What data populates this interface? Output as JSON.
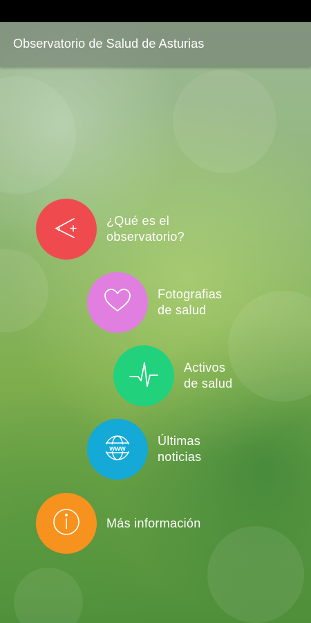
{
  "app_bar": {
    "title": "Observatorio de Salud de Asturias"
  },
  "menu": {
    "items": [
      {
        "label": "¿Qué es el\n observatorio?",
        "icon": "angle-plus-icon",
        "color": "#EF4B4F"
      },
      {
        "label": "Fotografias\n de salud",
        "icon": "heart-icon",
        "color": "#E07FE0"
      },
      {
        "label": "Activos\nde salud",
        "icon": "heartbeat-icon",
        "color": "#22D17C"
      },
      {
        "label": "Últimas\nnoticias",
        "icon": "globe-www-icon",
        "color": "#14A9D6"
      },
      {
        "label": "Más información",
        "icon": "info-icon",
        "color": "#F7921E"
      }
    ]
  }
}
